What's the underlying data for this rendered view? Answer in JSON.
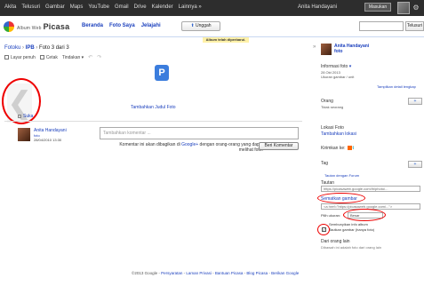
{
  "topbar": {
    "nav": [
      "Akita",
      "Telusuri",
      "Gambar",
      "Maps",
      "YouTube",
      "Gmail",
      "Drive",
      "Kalender",
      "Lainnya »"
    ],
    "user": "Anita Handayani",
    "user_btn": "Masukan",
    "settings_icon": "gear-icon"
  },
  "header": {
    "logo_small": "Album Web",
    "logo_main": "Picasa",
    "tabs": [
      "Beranda",
      "Foto Saya",
      "Jelajahi"
    ],
    "upload": "Unggah",
    "search_btn": "Telusuri"
  },
  "notice": "Album telah diperbarui.",
  "breadcrumb": {
    "root": "Fotoku",
    "album": "IPB",
    "position": "Foto 3 dari 3"
  },
  "toolbar": {
    "fullscreen": "Layar penuh",
    "slideshow": "Cetak",
    "actions": "Tindakan ▾"
  },
  "photo": {
    "icon_letter": "P",
    "add_title": "Tambahkan Judul Foto",
    "share": "Suka"
  },
  "comment": {
    "name": "Anita Handayani",
    "sub": "foto",
    "date": "28/04/2010 13:30",
    "placeholder": "Tambahkan komentar ...",
    "note_pre": "Komentar ini akan dibagikan di",
    "note_link": "Google+",
    "note_post": "dengan orang-orang yang dapat melihat foto.",
    "button": "Beri Komentar"
  },
  "sidebar": {
    "owner": "Anita Handayani",
    "owner_sub": "foto",
    "info": "Informasi foto",
    "date": "28 Okt 2013",
    "size": "Ukuran gambar / unit",
    "more": "Tampilkan detail lengkap",
    "people_h": "Orang",
    "people_v": "Tidak seorang",
    "people_btn": "+",
    "loc_h": "Lokasi Foto",
    "loc_v": "Tambahkan lokasi",
    "send": "Kirimkan ke:",
    "tag_h": "Tag",
    "tag_btn": "+",
    "map_link": "Tautan dengan Forum",
    "link_h": "Tautan",
    "link_val": "https://picasaweb.google.com/lh/photo/...",
    "embed": "Sematkan gambar",
    "embed_val": "<a href=\"https://picasaweb.google.com/...\">",
    "size_lbl": "Pilih ukuran:",
    "size_val": "Besar",
    "hide": "Sembunyikan info album",
    "chk_lbl": "Tautkan gambar (hanya foto)",
    "other_h": "Dari orang lain",
    "other_v": "Dibawah ini adalah foto dari orang lain"
  },
  "footer": {
    "copy": "©2013 Google",
    "links": [
      "Persyaratan",
      "Laman Privasi",
      "Bantuan Picasa",
      "Blog Picasa",
      "Berikan Google"
    ]
  }
}
